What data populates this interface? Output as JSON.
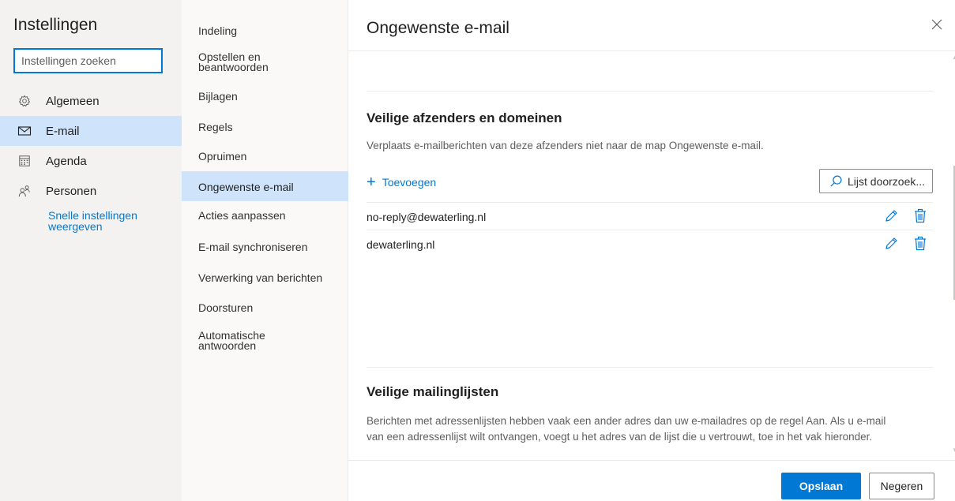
{
  "settings": {
    "title": "Instellingen",
    "search_placeholder": "Instellingen zoeken",
    "categories": [
      {
        "label": "Algemeen",
        "icon": "gear-icon"
      },
      {
        "label": "E-mail",
        "icon": "mail-icon",
        "active": true
      },
      {
        "label": "Agenda",
        "icon": "calendar-icon"
      },
      {
        "label": "Personen",
        "icon": "people-icon"
      }
    ],
    "quick_settings_link": "Snelle instellingen weergeven"
  },
  "mail_menu": {
    "items": [
      {
        "label": "Indeling"
      },
      {
        "label": "Opstellen en beantwoorden"
      },
      {
        "label": "Bijlagen"
      },
      {
        "label": "Regels"
      },
      {
        "label": "Opruimen"
      },
      {
        "label": "Ongewenste e-mail",
        "active": true
      },
      {
        "label": "Acties aanpassen"
      },
      {
        "label": "E-mail synchroniseren"
      },
      {
        "label": "Verwerking van berichten"
      },
      {
        "label": "Doorsturen"
      },
      {
        "label": "Automatische antwoorden"
      }
    ]
  },
  "panel": {
    "title": "Ongewenste e-mail",
    "safe_senders": {
      "title": "Veilige afzenders en domeinen",
      "description": "Verplaats e-mailberichten van deze afzenders niet naar de map Ongewenste e-mail.",
      "add_label": "Toevoegen",
      "search_label": "Lijst doorzoek...",
      "entries": [
        "no-reply@dewaterling.nl",
        "dewaterling.nl"
      ]
    },
    "safe_lists": {
      "title": "Veilige mailinglijsten",
      "description_line1": "Berichten met adressenlijsten hebben vaak een ander adres dan uw e-mailadres op de regel Aan. Als u e-mail",
      "description_line2": "van een adressenlijst wilt ontvangen, voegt u het adres van de lijst die u vertrouwt, toe in het vak hieronder."
    },
    "save_label": "Opslaan",
    "discard_label": "Negeren"
  },
  "colors": {
    "accent": "#0078d4",
    "selected_bg": "#cfe4fa"
  }
}
